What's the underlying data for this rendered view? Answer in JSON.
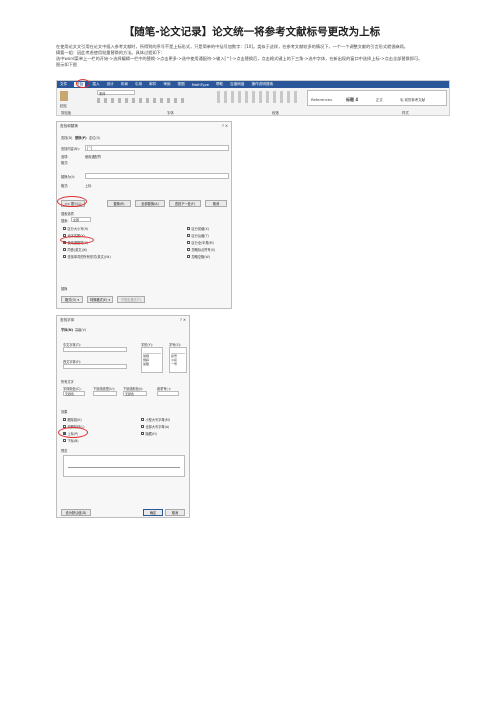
{
  "title": "【随笔-论文记录】论文统一将参考文献标号更改为上标",
  "intro": "在使用论文文引用在论文中插入参考文献时，所得到的序号不是上标形式，只是简单的中括号加数字：[10]。类似于这样，在参考文献较多的情况下，一个一个调整文献的引言形式就很麻烦。",
  "intro2": "摘要一组：因此考虑使用批量替换的方法。具体过程如下：",
  "steps": "选中word菜单上一栏的开始->选择编辑一栏中的替换->点击更多->选中使用通配符->输入[^]->点击替换后，点击格式键上的下三角->选中字体，在新出现的窗口中选择上标->点击全部替换即可。",
  "steps2": "图示如下图",
  "ribbon": {
    "tabs": [
      "文件",
      "开始",
      "插入",
      "设计",
      "布局",
      "引用",
      "邮件",
      "审阅",
      "视图",
      "MathType",
      "帮助",
      "百度网盘",
      "操作说明搜索"
    ],
    "clipboard": "剪贴板",
    "font_group": "字体",
    "paragraph_group": "段落",
    "styles_group": "样式",
    "font_name": "宋体",
    "styles": [
      "References",
      "标题 4",
      "格式文字",
      "正文",
      "毛-前的参考文献"
    ],
    "paste": "粘贴"
  },
  "find_dialog": {
    "title": "查找和替换",
    "tabs": [
      "查找(D)",
      "替换(P)",
      "定位(G)"
    ],
    "find_label": "查找内容(N):",
    "find_value": "[^]",
    "options_label": "选项:",
    "options_value": "使用通配符",
    "format_label": "格式:",
    "replace_label": "替换为(I):",
    "format_label2": "格式:",
    "format_value": "上标",
    "buttons": [
      "<< 更少(L)",
      "替换(R)",
      "全部替换(A)",
      "查找下一处(F)",
      "取消"
    ],
    "search_options": "搜索选项",
    "search_label": "搜索:",
    "search_value": "全部",
    "checkboxes_left": [
      "区分大小写(H)",
      "全字匹配(Y)",
      "使用通配符(U)",
      "同音(英文)(K)",
      "查找单词的所有形式(英文)(W)"
    ],
    "checkboxes_right": [
      "区分前缀(X)",
      "区分后缀(T)",
      "区分全/半角(M)",
      "忽略标点符号(S)",
      "忽略空格(W)"
    ],
    "replace_section": "替换",
    "bottom_buttons": [
      "格式(O) ▾",
      "特殊格式(E) ▾",
      "不限定格式(T)"
    ]
  },
  "font_dialog": {
    "title": "查找字体",
    "tabs": [
      "字体(N)",
      "高级(V)"
    ],
    "cjk_font": "中文字体(T):",
    "latin_font": "西文字体(F):",
    "style_label": "字形(Y):",
    "size_label": "字号(S):",
    "styles": [
      "常规",
      "倾斜",
      "加粗"
    ],
    "sizes": [
      "初号",
      "小初",
      "一号"
    ],
    "all_text": "所有文字",
    "font_color": "字体颜色(C):",
    "font_color_value": "无颜色",
    "underline": "下划线线型(U):",
    "underline_color": "下划线颜色(I):",
    "underline_color_value": "无颜色",
    "emphasis": "着重号(·):",
    "effects": "效果",
    "effects_left": [
      "删除线(K)",
      "双删除线(L)",
      "上标(P)",
      "下标(B)"
    ],
    "effects_right": [
      "小型大写字母(M)",
      "全部大写字母(A)",
      "隐藏(H)"
    ],
    "preview": "预览",
    "default_btn": "设为默认值(D)",
    "ok_btn": "确定",
    "cancel_btn": "取消"
  }
}
